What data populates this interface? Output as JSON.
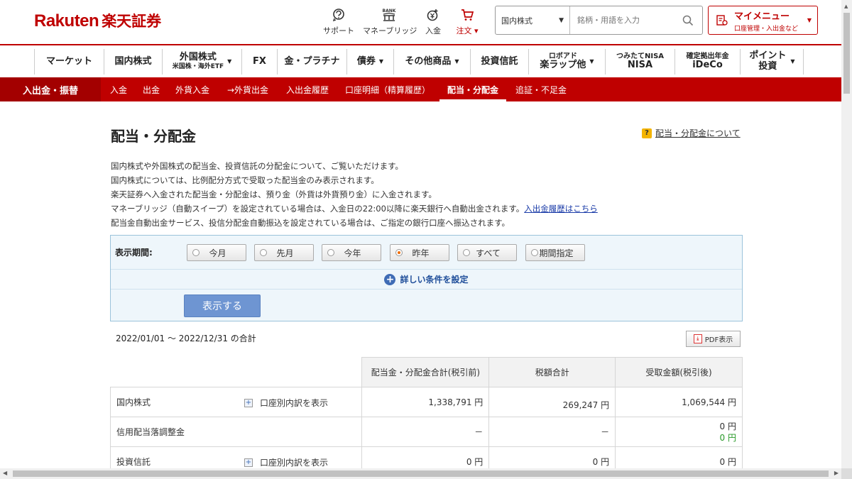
{
  "logo": {
    "en": "Rakuten",
    "jp": "楽天証券"
  },
  "header_tools": [
    {
      "label": "サポート",
      "icon": "support-icon"
    },
    {
      "label": "マネーブリッジ",
      "icon": "bank-icon",
      "icon_text": "BANK"
    },
    {
      "label": "入金",
      "icon": "deposit-icon"
    },
    {
      "label": "注文 ▾",
      "icon": "cart-icon"
    }
  ],
  "search": {
    "category": "国内株式",
    "placeholder": "銘柄・用語を入力"
  },
  "mymenu": {
    "title": "マイメニュー",
    "subtitle": "口座管理・入出金など"
  },
  "main_nav": [
    {
      "label": "マーケット"
    },
    {
      "label": "国内株式"
    },
    {
      "label": "外国株式",
      "sub": "米国株・海外ETF",
      "dropdown": true
    },
    {
      "label": "FX"
    },
    {
      "label": "金・プラチナ"
    },
    {
      "label": "債券",
      "dropdown": true
    },
    {
      "label": "その他商品",
      "dropdown": true
    },
    {
      "label": "投資信託"
    },
    {
      "label": "楽ラップ他",
      "small": "ロボアド",
      "dropdown": true
    },
    {
      "label": "NISA",
      "small": "つみたてNISA"
    },
    {
      "label": "iDeCo",
      "small": "確定拠出年金"
    },
    {
      "label": "ポイント投資",
      "dropdown": true
    }
  ],
  "sub_nav": {
    "head": "入出金・振替",
    "items": [
      "入金",
      "出金",
      "外貨入金",
      "→外貨出金",
      "入出金履歴",
      "口座明細（精算履歴）",
      "配当・分配金",
      "追証・不足金"
    ],
    "active": "配当・分配金"
  },
  "page": {
    "title": "配当・分配金",
    "help_link": "配当・分配金について",
    "desc": [
      "国内株式や外国株式の配当金、投資信託の分配金について、ご覧いただけます。",
      "国内株式については、比例配分方式で受取った配当金のみ表示されます。",
      "楽天証券へ入金された配当金・分配金は、預り金（外貨は外貨預り金）に入金されます。",
      "マネーブリッジ（自動スイープ）を設定されている場合は、入金日の22:00以降に楽天銀行へ自動出金されます。",
      "配当金自動出金サービス、投信分配金自動振込を設定されている場合は、ご指定の銀行口座へ振込されます。"
    ],
    "desc_link": "入出金履歴はこちら"
  },
  "filter": {
    "period_label": "表示期間:",
    "options": [
      "今月",
      "先月",
      "今年",
      "昨年",
      "すべて",
      "期間指定"
    ],
    "selected": "昨年",
    "more_conditions": "詳しい条件を設定",
    "submit": "表示する"
  },
  "summary": {
    "range": "2022/01/01 〜 2022/12/31 の合計",
    "pdf": "PDF表示",
    "columns": [
      "配当金・分配金合計(税引前)",
      "税額合計",
      "受取金額(税引後)"
    ],
    "breakdown_label": "口座別内訳を表示",
    "rows": [
      {
        "name": "国内株式",
        "breakdown": true,
        "gross": "1,338,791 円",
        "tax": "269,247 円",
        "net": "1,069,544 円",
        "net2": ""
      },
      {
        "name": "信用配当落調整金",
        "breakdown": false,
        "gross": "－",
        "tax": "－",
        "net": "0 円",
        "net2": "0 円"
      },
      {
        "name": "投資信託",
        "breakdown": true,
        "gross": "0 円",
        "tax": "0 円",
        "net": "0 円",
        "net2": ""
      }
    ]
  },
  "colors": {
    "brand_red": "#bf0000",
    "button_blue": "#6e95d2",
    "panel_bg": "#eef6fb",
    "positive_green": "#2a9a2a"
  }
}
